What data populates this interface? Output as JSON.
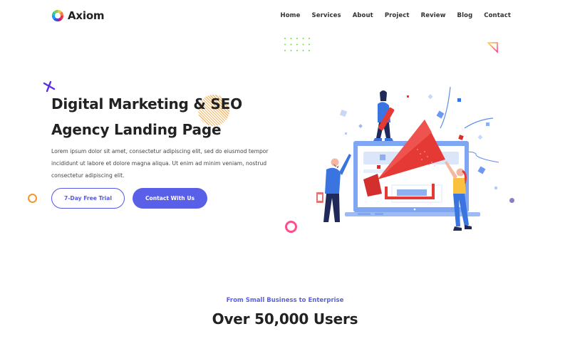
{
  "brand": {
    "name": "Axiom",
    "logo_icon": "color-wheel-icon"
  },
  "nav": {
    "items": [
      {
        "label": "Home"
      },
      {
        "label": "Services"
      },
      {
        "label": "About"
      },
      {
        "label": "Project"
      },
      {
        "label": "Review"
      },
      {
        "label": "Blog"
      },
      {
        "label": "Contact"
      }
    ]
  },
  "hero": {
    "title_line1": "Digital Marketing & SEO",
    "title_line2": "Agency Landing Page",
    "description": "Lorem ipsum dolor sit amet, consectetur adipiscing elit, sed do eiusmod tempor incididunt ut labore et dolore magna aliqua. Ut enim ad minim veniam, nostrud consectetur adipiscing elit.",
    "primary_cta": "Contact With Us",
    "secondary_cta": "7-Day Free Trial",
    "illustration": "marketing-megaphone-laptop-illustration"
  },
  "stats": {
    "subheading": "From Small Business to Enterprise",
    "heading": "Over 50,000 Users"
  },
  "colors": {
    "accent": "#5a5fe8",
    "orange": "#f7962d",
    "pink": "#ff4d8d",
    "purple_cross": "#5b2ee6",
    "green_dots": "#6ddf4a",
    "megaphone_red": "#e53935",
    "laptop_blue": "#7fa6f2"
  }
}
